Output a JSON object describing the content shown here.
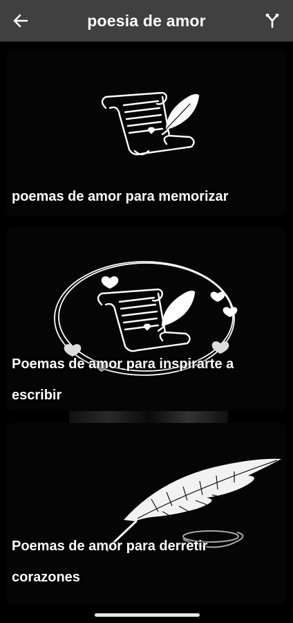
{
  "appbar": {
    "title": "poesia de amor",
    "back_icon": "arrow-back-icon",
    "share_icon": "share-icon"
  },
  "cards": [
    {
      "label": "poemas de amor para memorizar",
      "image": "scroll-quill-icon"
    },
    {
      "label": "Poemas de amor para inspirarte a escribir",
      "image": "scroll-quill-hearts-wreath"
    },
    {
      "label": "Poemas de amor para derretir corazones",
      "image": "feather-quill"
    }
  ],
  "colors": {
    "appbar": "#404040",
    "background": "#000000",
    "text": "#ffffff"
  }
}
